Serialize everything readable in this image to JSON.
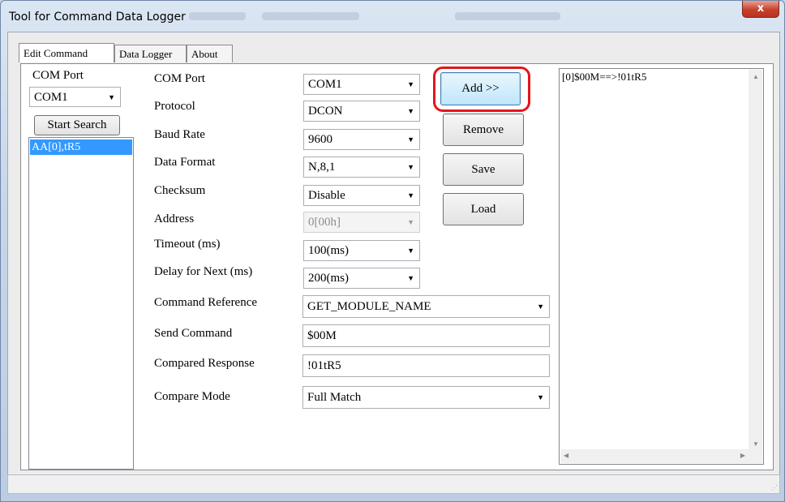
{
  "window": {
    "title": "Tool for Command Data Logger",
    "close_glyph": "x"
  },
  "tabs": [
    {
      "label": "Edit Command",
      "active": true
    },
    {
      "label": "Data Logger",
      "active": false
    },
    {
      "label": "About",
      "active": false
    }
  ],
  "left": {
    "com_port_label": "COM Port",
    "com_port_value": "COM1",
    "search_button": "Start Search",
    "found_items": [
      "AA[0],tR5"
    ]
  },
  "form": {
    "com_port": {
      "label": "COM Port",
      "value": "COM1"
    },
    "protocol": {
      "label": "Protocol",
      "value": "DCON"
    },
    "baud_rate": {
      "label": "Baud Rate",
      "value": "9600"
    },
    "data_format": {
      "label": "Data Format",
      "value": "N,8,1"
    },
    "checksum": {
      "label": "Checksum",
      "value": "Disable"
    },
    "address": {
      "label": "Address",
      "value": "0[00h]"
    },
    "timeout": {
      "label": "Timeout (ms)",
      "value": "100(ms)"
    },
    "delay": {
      "label": "Delay for Next (ms)",
      "value": "200(ms)"
    },
    "command_reference": {
      "label": "Command Reference",
      "value": "GET_MODULE_NAME"
    },
    "send_command": {
      "label": "Send Command",
      "value": "$00M"
    },
    "compared_response": {
      "label": "Compared Response",
      "value": "!01tR5"
    },
    "compare_mode": {
      "label": "Compare Mode",
      "value": "Full Match"
    }
  },
  "actions": {
    "add": "Add >>",
    "remove": "Remove",
    "save": "Save",
    "load": "Load"
  },
  "command_list": [
    "[0]$00M==>!01tR5"
  ],
  "colors": {
    "highlight": "#e4161b",
    "selection": "#3399ff"
  },
  "icons": {
    "dropdown": "chevron-down-icon",
    "close": "close-icon"
  }
}
